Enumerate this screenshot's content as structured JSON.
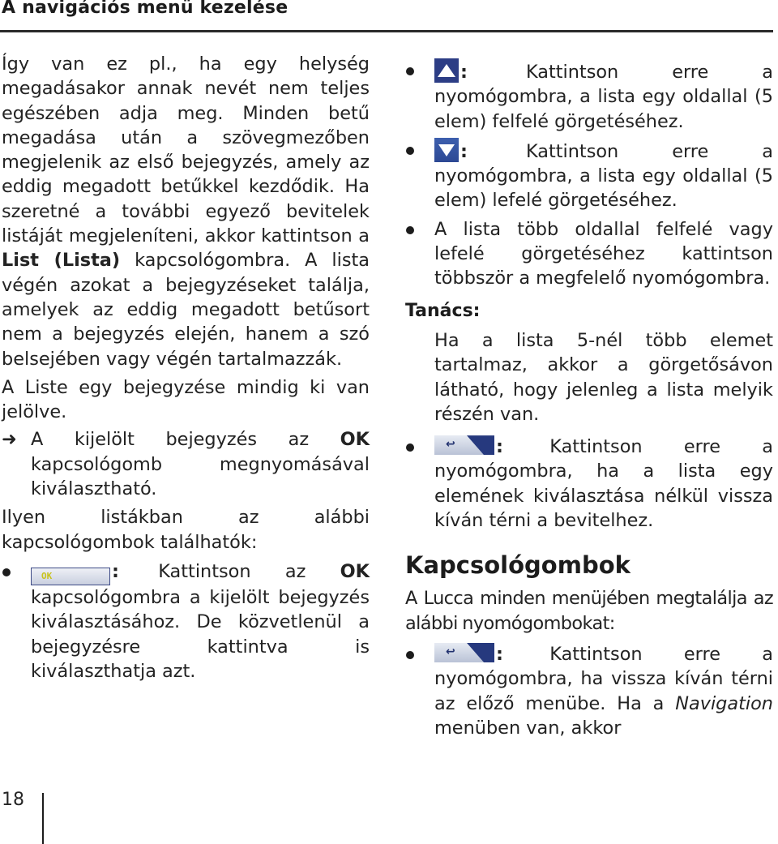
{
  "header": {
    "title": "A navigációs menü kezelése"
  },
  "left_column": {
    "intro_paragraph": {
      "p1": "Így van ez pl., ha egy helység megadásakor annak nevét nem teljes egészében adja meg. Minden betű megadása után a szövegmezőben megjelenik az első bejegyzés, amely az eddig megadott betűkkel kezdődik. Ha szeretné a további egyező bevitelek listáját megjeleníteni, akkor kattintson a ",
      "bold_list": "List (Lista)",
      "p2": " kapcsológombra. A lista végén azokat a bejegyzéseket találja, amelyek az eddig megadott betűsort nem a bejegyzés elején, hanem a szó belsejében vagy végén tartalmazzák."
    },
    "selected_paragraph": "A Liste egy bejegyzése mindig ki van jelölve.",
    "arrow_item": {
      "glyph": "➜",
      "text_before": "A kijelölt bejegyzés az ",
      "bold_ok": "OK",
      "text_after": " kapcsológomb megnyomásával kiválasztható."
    },
    "buttons_intro": "Ilyen listákban az alábbi kapcsológombok találhatók:",
    "ok_bullet": {
      "icon_label": "OK",
      "colon": ":",
      "text_before": "Kattintson az ",
      "bold_ok": "OK",
      "text_after": " kapcsológombra a kijelölt bejegyzés kiválasztásához. De közvetlenül a bejegyzésre kattintva is kiválaszthatja azt."
    }
  },
  "right_column": {
    "bullets": [
      {
        "icon": "arrow-up-icon",
        "colon": ":",
        "text": "Kattintson erre a nyomógombra, a lista egy oldallal (5 elem) felfelé görgetéséhez."
      },
      {
        "icon": "arrow-down-icon",
        "colon": ":",
        "text": "Kattintson erre a nyomógombra, a lista egy oldallal (5 elem) lefelé görgetéséhez."
      },
      {
        "icon": "",
        "text": "A lista több oldallal felfelé vagy lefelé görgetéséhez kattintson többször a megfelelő nyomógombra."
      }
    ],
    "tip": {
      "heading": "Tanács:",
      "text": "Ha a lista 5-nél több elemet tartalmaz, akkor a görgetősávon látható, hogy jelenleg a lista melyik részén van."
    },
    "back_bullet_list": {
      "icon": "back-icon",
      "icon_glyph": "↩",
      "colon": ":",
      "text": "Kattintson erre a nyomógombra, ha a lista egy elemének kiválasztása nélkül vissza kíván térni a bevitelhez."
    },
    "section": {
      "title": "Kapcsológombok",
      "intro": "A Lucca minden menüjében megtalálja az alábbi nyomógombokat:",
      "back_bullet": {
        "icon": "back-icon",
        "icon_glyph": "↩",
        "colon": ":",
        "text_before": "Kattintson erre a nyomógombra, ha vissza kíván térni az előző menübe. Ha a ",
        "italic": "Navigation",
        "text_after": " menüben van, akkor"
      }
    }
  },
  "footer": {
    "page_number": "18"
  },
  "colors": {
    "text": "#232323",
    "icon_navy": "#2c3d85",
    "icon_blue": "#3d5fae",
    "ok_text": "#c8c21e"
  }
}
